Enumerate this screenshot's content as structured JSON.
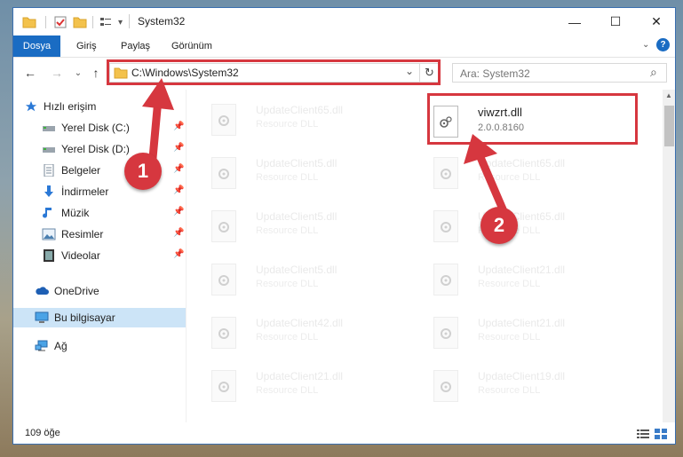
{
  "window": {
    "title": "System32",
    "buttons": {
      "minimize": "—",
      "maximize": "☐",
      "close": "✕"
    }
  },
  "ribbon": {
    "tabs": [
      "Dosya",
      "Giriş",
      "Paylaş",
      "Görünüm"
    ],
    "help_icon": "?"
  },
  "navigation": {
    "back": "←",
    "forward": "→",
    "recent": "⌄",
    "up": "↑",
    "address": "C:\\Windows\\System32",
    "address_dropdown": "⌄",
    "refresh": "↻",
    "search_placeholder": "Ara: System32",
    "search_icon": "⌕"
  },
  "sidebar": {
    "quick_access": "Hızlı erişim",
    "items": [
      {
        "label": "Yerel Disk (C:)",
        "icon": "drive-icon",
        "pinned": true
      },
      {
        "label": "Yerel Disk (D:)",
        "icon": "drive-icon",
        "pinned": true
      },
      {
        "label": "Belgeler",
        "icon": "documents-icon",
        "pinned": true
      },
      {
        "label": "İndirmeler",
        "icon": "downloads-icon",
        "pinned": true
      },
      {
        "label": "Müzik",
        "icon": "music-icon",
        "pinned": true
      },
      {
        "label": "Resimler",
        "icon": "pictures-icon",
        "pinned": true
      },
      {
        "label": "Videolar",
        "icon": "videos-icon",
        "pinned": true
      }
    ],
    "onedrive": "OneDrive",
    "this_pc": "Bu bilgisayar",
    "network": "Ağ"
  },
  "files": {
    "left_column": [
      {
        "name": "UpdateClient65.dll",
        "desc": "Resource DLL"
      },
      {
        "name": "UpdateClient5.dll",
        "desc": "Resource DLL"
      },
      {
        "name": "UpdateClient5.dll",
        "desc": "Resource DLL"
      },
      {
        "name": "UpdateClient5.dll",
        "desc": "Resource DLL"
      },
      {
        "name": "UpdateClient42.dll",
        "desc": "Resource DLL"
      },
      {
        "name": "UpdateClient21.dll",
        "desc": "Resource DLL"
      }
    ],
    "right_column": [
      {
        "name": "viwzrt.dll",
        "desc": "2.0.0.8160",
        "active": true
      },
      {
        "name": "UpdateClient65.dll",
        "desc": "Resource DLL"
      },
      {
        "name": "UpdateClient65.dll",
        "desc": "Resource DLL"
      },
      {
        "name": "UpdateClient21.dll",
        "desc": "Resource DLL"
      },
      {
        "name": "UpdateClient21.dll",
        "desc": "Resource DLL"
      },
      {
        "name": "UpdateClient19.dll",
        "desc": "Resource DLL"
      }
    ]
  },
  "status": {
    "item_count": "109 öğe"
  },
  "annotations": {
    "step1": "1",
    "step2": "2",
    "color": "#d6373f"
  }
}
